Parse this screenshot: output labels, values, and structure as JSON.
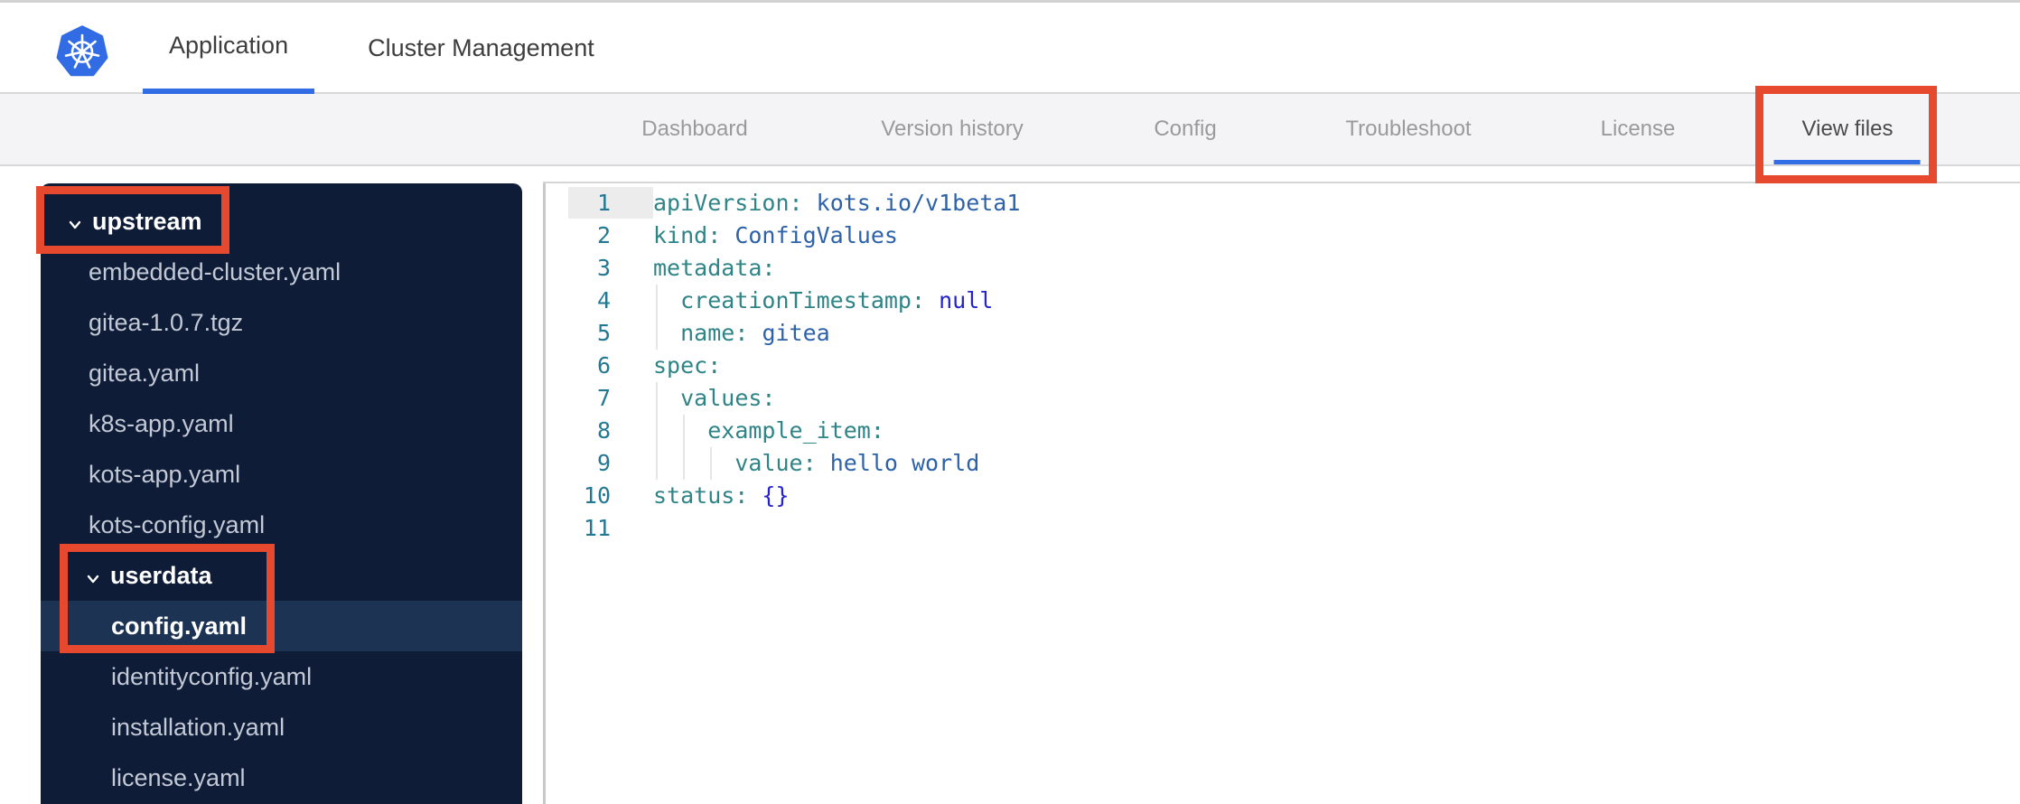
{
  "topnav": {
    "tabs": [
      {
        "label": "Application",
        "active": true
      },
      {
        "label": "Cluster Management",
        "active": false
      }
    ]
  },
  "subnav": {
    "tabs": [
      {
        "label": "Dashboard",
        "active": false
      },
      {
        "label": "Version history",
        "active": false
      },
      {
        "label": "Config",
        "active": false
      },
      {
        "label": "Troubleshoot",
        "active": false
      },
      {
        "label": "License",
        "active": false
      },
      {
        "label": "View files",
        "active": true
      }
    ]
  },
  "file_tree": {
    "items": [
      {
        "label": "upstream",
        "type": "folder",
        "level": 0,
        "expanded": true
      },
      {
        "label": "embedded-cluster.yaml",
        "type": "file",
        "level": 1,
        "selected": false
      },
      {
        "label": "gitea-1.0.7.tgz",
        "type": "file",
        "level": 1,
        "selected": false
      },
      {
        "label": "gitea.yaml",
        "type": "file",
        "level": 1,
        "selected": false
      },
      {
        "label": "k8s-app.yaml",
        "type": "file",
        "level": 1,
        "selected": false
      },
      {
        "label": "kots-app.yaml",
        "type": "file",
        "level": 1,
        "selected": false
      },
      {
        "label": "kots-config.yaml",
        "type": "file",
        "level": 1,
        "selected": false
      },
      {
        "label": "userdata",
        "type": "folder",
        "level": 1,
        "expanded": true
      },
      {
        "label": "config.yaml",
        "type": "file",
        "level": 2,
        "selected": true
      },
      {
        "label": "identityconfig.yaml",
        "type": "file",
        "level": 2,
        "selected": false
      },
      {
        "label": "installation.yaml",
        "type": "file",
        "level": 2,
        "selected": false
      },
      {
        "label": "license.yaml",
        "type": "file",
        "level": 2,
        "selected": false
      }
    ]
  },
  "editor": {
    "lines": [
      {
        "n": 1,
        "indent": 0,
        "active": true,
        "tokens": [
          [
            "apiVersion:",
            "key"
          ],
          [
            " ",
            "plain"
          ],
          [
            "kots.io/v1beta1",
            "value"
          ]
        ]
      },
      {
        "n": 2,
        "indent": 0,
        "active": false,
        "tokens": [
          [
            "kind:",
            "key"
          ],
          [
            " ",
            "plain"
          ],
          [
            "ConfigValues",
            "value"
          ]
        ]
      },
      {
        "n": 3,
        "indent": 0,
        "active": false,
        "tokens": [
          [
            "metadata:",
            "key"
          ]
        ]
      },
      {
        "n": 4,
        "indent": 2,
        "active": false,
        "tokens": [
          [
            "creationTimestamp:",
            "key"
          ],
          [
            " ",
            "plain"
          ],
          [
            "null",
            "keyword"
          ]
        ]
      },
      {
        "n": 5,
        "indent": 2,
        "active": false,
        "tokens": [
          [
            "name:",
            "key"
          ],
          [
            " ",
            "plain"
          ],
          [
            "gitea",
            "value"
          ]
        ]
      },
      {
        "n": 6,
        "indent": 0,
        "active": false,
        "tokens": [
          [
            "spec:",
            "key"
          ]
        ]
      },
      {
        "n": 7,
        "indent": 2,
        "active": false,
        "tokens": [
          [
            "values:",
            "key"
          ]
        ]
      },
      {
        "n": 8,
        "indent": 4,
        "active": false,
        "tokens": [
          [
            "example_item:",
            "key"
          ]
        ]
      },
      {
        "n": 9,
        "indent": 6,
        "active": false,
        "tokens": [
          [
            "value:",
            "key"
          ],
          [
            " ",
            "plain"
          ],
          [
            "hello world",
            "value"
          ]
        ]
      },
      {
        "n": 10,
        "indent": 0,
        "active": false,
        "tokens": [
          [
            "status:",
            "key"
          ],
          [
            " ",
            "plain"
          ],
          [
            "{}",
            "keyword"
          ]
        ]
      },
      {
        "n": 11,
        "indent": 0,
        "active": false,
        "tokens": []
      }
    ]
  },
  "icons": {
    "logo": "kubernetes-helm-wheel",
    "folder_chevron": "chevron-down"
  },
  "colors": {
    "accent_blue": "#326de6",
    "annotation_red": "#e6492d",
    "sidebar_bg": "#0e1c38",
    "sidebar_selected_bg": "#1d3354",
    "sidebar_file_text": "#c3c9d5",
    "subnav_bg": "#f4f4f6",
    "code_key": "#2e8486",
    "code_value": "#2d62a9",
    "code_keyword": "#2423ce",
    "line_number": "#237893"
  }
}
